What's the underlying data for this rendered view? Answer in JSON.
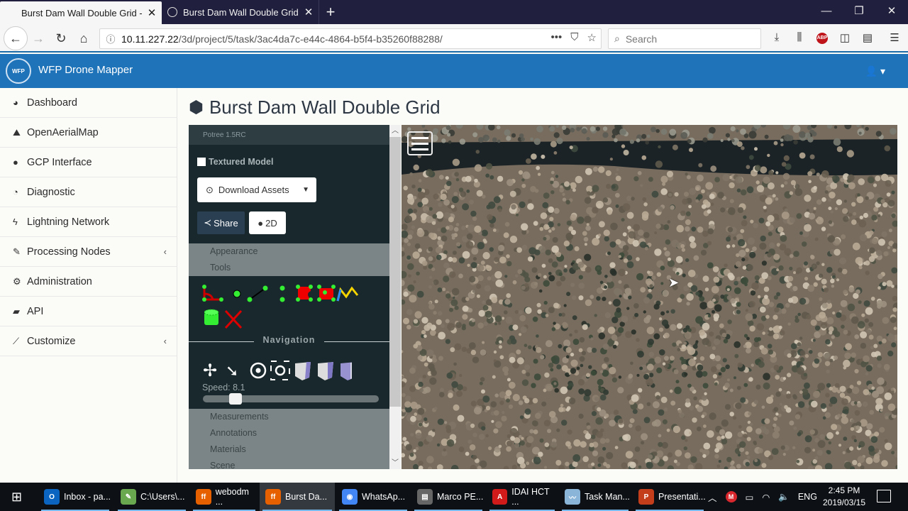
{
  "browser": {
    "tabs": [
      {
        "title": "Burst Dam Wall Double Grid - W",
        "active": true
      },
      {
        "title": "Burst Dam Wall Double Grid - W",
        "active": false
      }
    ],
    "new_tab_icon": "+",
    "window_controls": {
      "minimize": "—",
      "restore": "❐",
      "close": "✕"
    },
    "url_host": "10.11.227.22",
    "url_path": "/3d/project/5/task/3ac4da7c-e44c-4864-b5f4-b35260f88288/",
    "search_placeholder": "Search",
    "abp_label": "ABP"
  },
  "app": {
    "title": "WFP Drone Mapper",
    "logo_text": "WFP",
    "sidebar": {
      "items": [
        {
          "label": "Dashboard",
          "icon": "tachometer-icon",
          "glyph": "◕",
          "expandable": false
        },
        {
          "label": "OpenAerialMap",
          "icon": "rocket-icon",
          "glyph": "⛰",
          "expandable": false
        },
        {
          "label": "GCP Interface",
          "icon": "map-marker-icon",
          "glyph": "📍",
          "expandable": false
        },
        {
          "label": "Diagnostic",
          "icon": "pie-chart-icon",
          "glyph": "◔",
          "expandable": false
        },
        {
          "label": "Lightning Network",
          "icon": "bolt-icon",
          "glyph": "ϟ",
          "expandable": false
        },
        {
          "label": "Processing Nodes",
          "icon": "wrench-icon",
          "glyph": "🔧",
          "expandable": true
        },
        {
          "label": "Administration",
          "icon": "gears-icon",
          "glyph": "⚙",
          "expandable": false
        },
        {
          "label": "API",
          "icon": "book-icon",
          "glyph": "▰",
          "expandable": false
        },
        {
          "label": "Customize",
          "icon": "magic-wand-icon",
          "glyph": "⁄",
          "expandable": true
        }
      ],
      "chevron": "‹"
    },
    "page_title": "Burst Dam Wall Double Grid",
    "potree": {
      "version": "Potree 1.5RC",
      "textured_model_label": "Textured Model",
      "textured_model_checked": false,
      "download_label": "Download Assets",
      "share_label": "Share",
      "twod_label": "2D",
      "sections_top": [
        "Appearance",
        "Tools"
      ],
      "navigation_label": "Navigation",
      "speed_label": "Speed: 8.1",
      "speed_value": 8.1,
      "speed_fraction": 0.16,
      "sections_bottom": [
        "Measurements",
        "Annotations",
        "Materials",
        "Scene"
      ]
    }
  },
  "taskbar": {
    "apps": [
      {
        "label": "Inbox - pa...",
        "icon": "outlook-icon",
        "color": "#0b64c0",
        "glyph": "O"
      },
      {
        "label": "C:\\Users\\...",
        "icon": "notepad-icon",
        "color": "#6aa84f",
        "glyph": "✎"
      },
      {
        "label": "webodm ...",
        "icon": "firefox-icon",
        "color": "#e66000",
        "glyph": "ff"
      },
      {
        "label": "Burst Da...",
        "icon": "firefox-icon",
        "color": "#e66000",
        "glyph": "ff",
        "active": true
      },
      {
        "label": "WhatsAp...",
        "icon": "chrome-icon",
        "color": "#4285f4",
        "glyph": "◉"
      },
      {
        "label": "Marco PE...",
        "icon": "chat-icon",
        "color": "#666666",
        "glyph": "▤"
      },
      {
        "label": "IDAI HCT ...",
        "icon": "pdf-icon",
        "color": "#d11a1a",
        "glyph": "A"
      },
      {
        "label": "Task Man...",
        "icon": "task-manager-icon",
        "color": "#8ab4d8",
        "glyph": "〰"
      },
      {
        "label": "Presentati...",
        "icon": "powerpoint-icon",
        "color": "#c43e1c",
        "glyph": "P"
      }
    ],
    "language": "ENG",
    "time": "2:45 PM",
    "date": "2019/03/15"
  }
}
